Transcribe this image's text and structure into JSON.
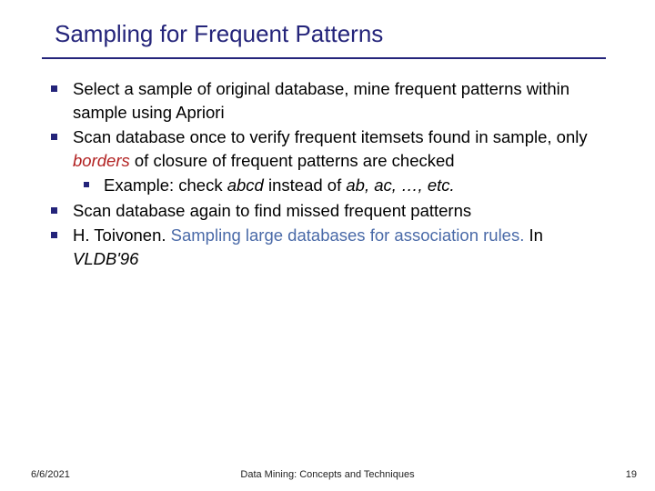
{
  "title": "Sampling for Frequent Patterns",
  "bullets": {
    "b1": "Select a sample of original database, mine frequent patterns within sample using Apriori",
    "b2a": "Scan database once to verify frequent itemsets found in sample, only ",
    "b2_borders": "borders",
    "b2b": " of closure of frequent patterns are checked",
    "b2_sub_a": "Example: check ",
    "b2_sub_abcd": "abcd",
    "b2_sub_b": " instead of ",
    "b2_sub_list": "ab, ac, …, etc.",
    "b3": "Scan database again to find missed frequent patterns",
    "b4a": "H. Toivonen. ",
    "b4_ref": "Sampling large databases for association rules.",
    "b4b": " In ",
    "b4_venue": "VLDB'96"
  },
  "footer": {
    "date": "6/6/2021",
    "center": "Data Mining: Concepts and Techniques",
    "page": "19"
  }
}
